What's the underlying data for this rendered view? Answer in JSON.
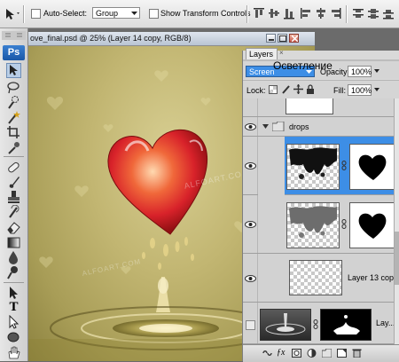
{
  "options_bar": {
    "auto_select_label": "Auto-Select:",
    "auto_select_value": "Group",
    "show_transform_label": "Show Transform Controls"
  },
  "toolbox": {
    "logo": "Ps",
    "type_tool_glyph": "T"
  },
  "document": {
    "title": "ove_final.psd @ 25% (Layer 14 copy, RGB/8)",
    "watermark": "ALFOART.COM"
  },
  "layers_panel": {
    "tab_label": "Layers",
    "tab_close": "×",
    "blend_mode": "Screen",
    "overlay_text": "Осветление",
    "opacity_label": "Opacity:",
    "opacity_value": "100%",
    "lock_label": "Lock:",
    "fill_label": "Fill:",
    "fill_value": "100%",
    "group_name": "drops",
    "layer13_name": "Layer 13 cop...",
    "bottom_layer_name": "Lay..."
  },
  "colors": {
    "selection_blue": "#3d8ee6",
    "canvas_gold": "#c2b672",
    "heart_red": "#d8222a"
  }
}
